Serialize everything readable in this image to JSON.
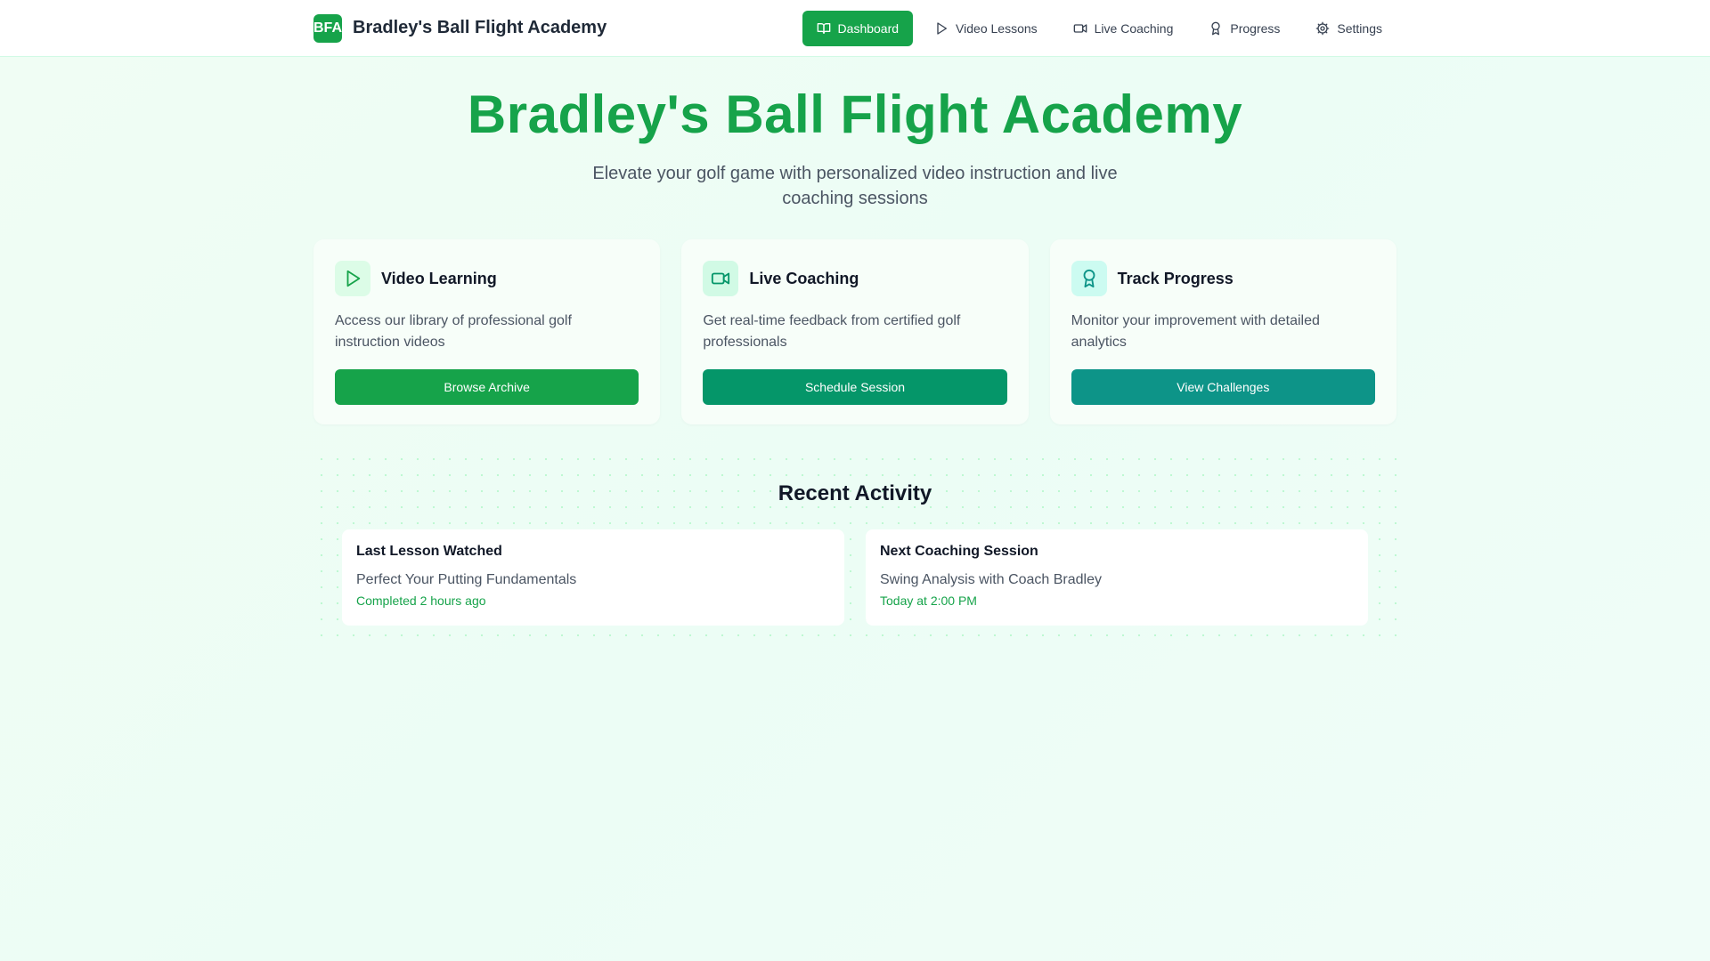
{
  "nav": {
    "logo_text": "BFA",
    "brand": "Bradley's Ball Flight Academy",
    "links": [
      {
        "label": "Dashboard",
        "icon": "book-open-icon"
      },
      {
        "label": "Video Lessons",
        "icon": "play-icon"
      },
      {
        "label": "Live Coaching",
        "icon": "video-camera-icon"
      },
      {
        "label": "Progress",
        "icon": "award-icon"
      },
      {
        "label": "Settings",
        "icon": "gear-icon"
      }
    ]
  },
  "hero": {
    "title": "Bradley's Ball Flight Academy",
    "subtitle": "Elevate your golf game with personalized video instruction and live coaching sessions"
  },
  "features": [
    {
      "title": "Video Learning",
      "description": "Access our library of professional golf instruction videos",
      "button": "Browse Archive",
      "icon": "play-icon",
      "color": "#16a34a",
      "icon_bg": "#dcfce7"
    },
    {
      "title": "Live Coaching",
      "description": "Get real-time feedback from certified golf professionals",
      "button": "Schedule Session",
      "icon": "video-camera-icon",
      "color": "#059669",
      "icon_bg": "#d1fae5"
    },
    {
      "title": "Track Progress",
      "description": "Monitor your improvement with detailed analytics",
      "button": "View Challenges",
      "icon": "award-icon",
      "color": "#0d9488",
      "icon_bg": "#ccfbf1"
    }
  ],
  "activity": {
    "title": "Recent Activity",
    "items": [
      {
        "label": "Last Lesson Watched",
        "text": "Perfect Your Putting Fundamentals",
        "meta": "Completed 2 hours ago"
      },
      {
        "label": "Next Coaching Session",
        "text": "Swing Analysis with Coach Bradley",
        "meta": "Today at 2:00 PM"
      }
    ]
  },
  "colors": {
    "primary": "#16a34a",
    "secondary": "#059669",
    "tertiary": "#0d9488"
  }
}
